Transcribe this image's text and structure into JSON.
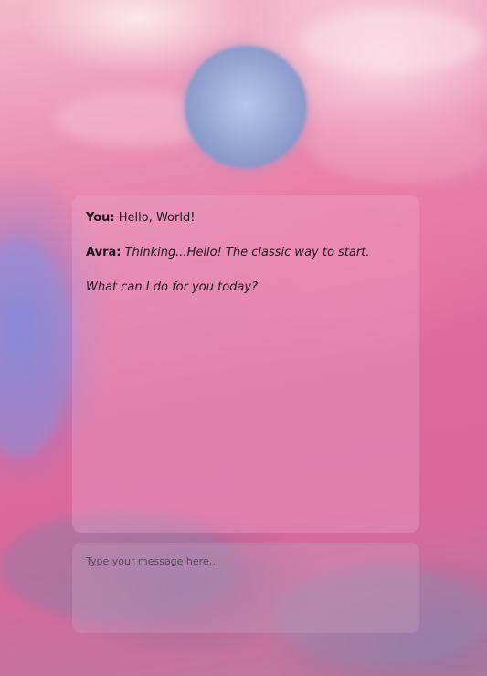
{
  "chat": {
    "messages": [
      {
        "speaker": "You:",
        "text": "Hello, World!"
      },
      {
        "speaker": "Avra:",
        "text": "Thinking...Hello! The classic way to start."
      },
      {
        "speaker": "",
        "text": "What can I do for you today?"
      }
    ]
  },
  "input": {
    "placeholder": "Type your message here..."
  },
  "colors": {
    "orb": "#9fb0db",
    "panel": "#eeaacd",
    "background_pink": "#dd6b9c",
    "background_blue": "#7882dc"
  }
}
